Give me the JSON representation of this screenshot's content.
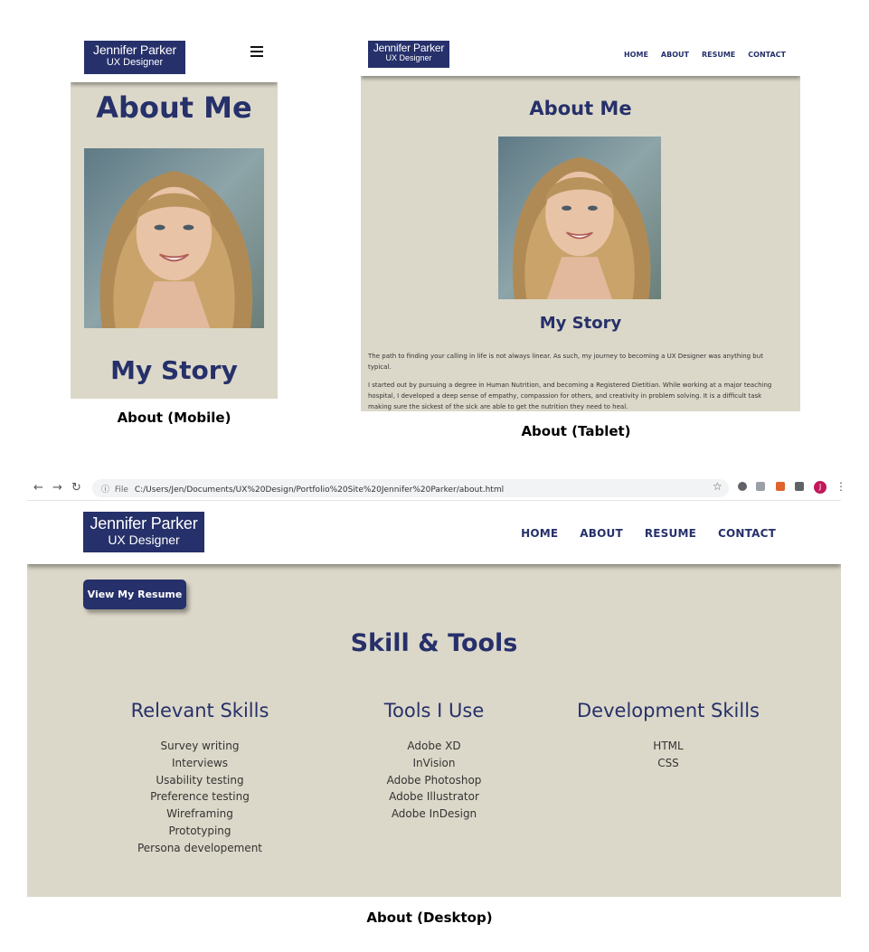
{
  "logo": {
    "name": "Jennifer Parker",
    "role": "UX Designer"
  },
  "nav": [
    "HOME",
    "ABOUT",
    "RESUME",
    "CONTACT"
  ],
  "colors": {
    "navy": "#26306a",
    "beige": "#dcd8c9",
    "avatar": "#c2185b"
  },
  "mobile": {
    "caption": "About (Mobile)",
    "heading": "About Me",
    "subheading": "My Story",
    "menu_icon": "hamburger-icon"
  },
  "tablet": {
    "caption": "About (Tablet)",
    "heading": "About Me",
    "subheading": "My Story",
    "paragraphs": [
      "The path to finding your calling in life is not always linear. As such, my journey to becoming a UX Designer was anything but typical.",
      "I started out by pursuing a degree in Human Nutrition, and becoming a Registered Dietitian. While working at a major teaching hospital, I developed a deep sense of empathy, compassion for others, and creativity in problem solving. It is a difficult task making sure the sickest of the sick are able to get the nutrition they need to heal."
    ]
  },
  "browser": {
    "url_prefix": "File",
    "url": "C:/Users/Jen/Documents/UX%20Design/Portfolio%20Site%20Jennifer%20Parker/about.html",
    "avatar_initial": "J"
  },
  "desktop": {
    "caption": "About (Desktop)",
    "resume_button": "View My Resume",
    "skills_heading": "Skill & Tools",
    "columns": [
      {
        "title": "Relevant Skills",
        "items": [
          "Survey writing",
          "Interviews",
          "Usability testing",
          "Preference testing",
          "Wireframing",
          "Prototyping",
          "Persona developement"
        ]
      },
      {
        "title": "Tools I Use",
        "items": [
          "Adobe XD",
          "InVision",
          "Adobe Photoshop",
          "Adobe Illustrator",
          "Adobe InDesign"
        ]
      },
      {
        "title": "Development Skills",
        "items": [
          "HTML",
          "CSS"
        ]
      }
    ]
  }
}
